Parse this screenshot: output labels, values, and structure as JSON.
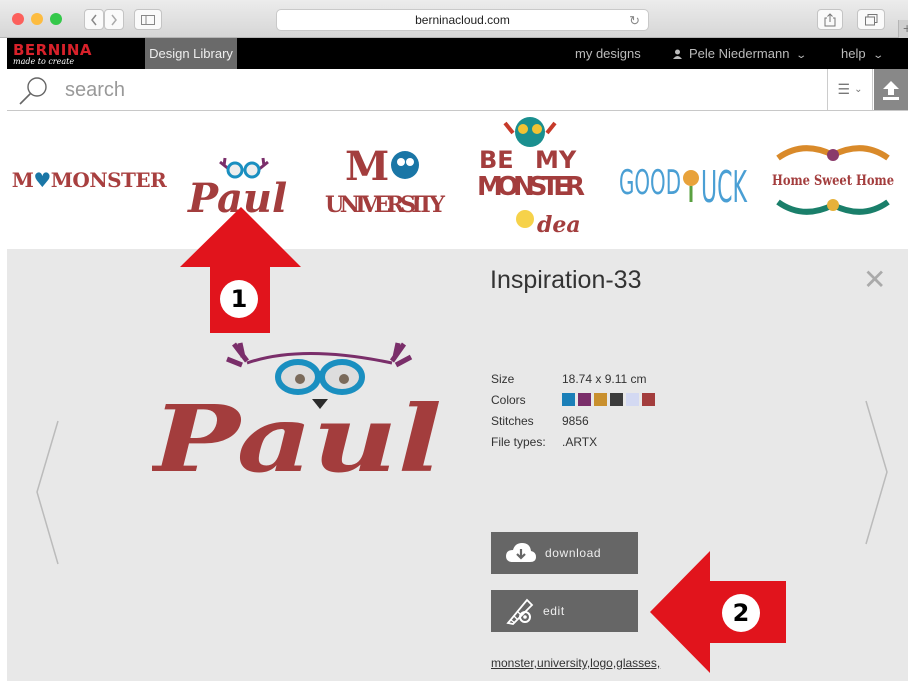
{
  "browser": {
    "url": "berninacloud.com",
    "traffic_colors": [
      "#fc605c",
      "#fdbc40",
      "#34c84a"
    ],
    "plus_tab": "+"
  },
  "header": {
    "brand": "BERNINA",
    "brand_tagline": "made to create",
    "active_tab": "Design Library",
    "my_designs": "my designs",
    "user_name": "Pele Niedermann",
    "help": "help"
  },
  "search": {
    "placeholder": "search",
    "value": ""
  },
  "thumbnails": [
    {
      "name": "MY MONSTER",
      "text_a": "M",
      "text_b": "MONSTER"
    },
    {
      "name": "Paul",
      "text": "Paul"
    },
    {
      "name": "MY UNIVERSITY",
      "text_a": "M",
      "text_b": "UNIVERSITY"
    },
    {
      "name": "BE MY MONSTER idea",
      "line1": "BE",
      "line1b": "MY",
      "line2": "MONSTER",
      "line3": "dea"
    },
    {
      "name": "GOOD LUCK",
      "text": "GOOD",
      "text_b": "UCK"
    },
    {
      "name": "Home Sweet Home",
      "text": "Home Sweet Home"
    }
  ],
  "detail": {
    "title": "Inspiration-33",
    "preview_text": "Paul",
    "size_label": "Size",
    "size_value": "18.74 x 9.11 cm",
    "colors_label": "Colors",
    "colors": [
      "#1a7fb8",
      "#7a2e6a",
      "#c9902e",
      "#3b3b3b",
      "#d3d9f2",
      "#a33d3d"
    ],
    "stitches_label": "Stitches",
    "stitches_value": "9856",
    "filetypes_label": "File types:",
    "filetypes_value": ".ARTX",
    "download_label": "download",
    "edit_label": "edit",
    "tags": "monster,university,logo,glasses,"
  },
  "annotations": {
    "badge_1": "1",
    "badge_2": "2",
    "color": "#e1141c"
  }
}
